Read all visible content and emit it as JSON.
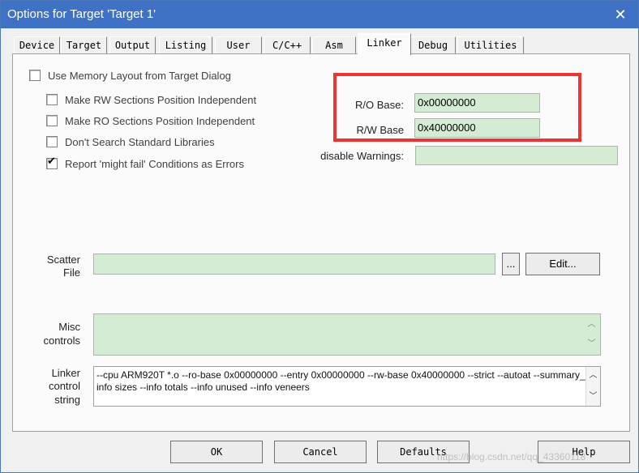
{
  "window": {
    "title": "Options for Target 'Target 1'",
    "close_glyph": "✕"
  },
  "tabs": [
    {
      "label": "Device"
    },
    {
      "label": "Target"
    },
    {
      "label": "Output"
    },
    {
      "label": "Listing"
    },
    {
      "label": "User"
    },
    {
      "label": "C/C++"
    },
    {
      "label": "Asm"
    },
    {
      "label": "Linker",
      "active": true
    },
    {
      "label": "Debug"
    },
    {
      "label": "Utilities"
    }
  ],
  "options": {
    "use_memory_layout": {
      "label": "Use Memory Layout from Target Dialog",
      "checked": false
    },
    "rw_independent": {
      "label": "Make RW Sections Position Independent",
      "checked": false
    },
    "ro_independent": {
      "label": "Make RO Sections Position Independent",
      "checked": false
    },
    "dont_search_libs": {
      "label": "Don't Search Standard Libraries",
      "checked": false
    },
    "might_fail_errors": {
      "label": "Report 'might fail' Conditions as Errors",
      "checked": true,
      "mark": "✔"
    }
  },
  "bases": {
    "ro_label": "R/O Base:",
    "ro_value": "0x00000000",
    "rw_label": "R/W Base",
    "rw_value": "0x40000000",
    "warnings_label": "disable Warnings:",
    "warnings_value": ""
  },
  "scatter": {
    "label_line1": "Scatter",
    "label_line2": "File",
    "value": "",
    "browse_label": "...",
    "edit_label": "Edit..."
  },
  "misc": {
    "label_line1": "Misc",
    "label_line2": "controls",
    "value": ""
  },
  "linker_string": {
    "label_line1": "Linker",
    "label_line2": "control",
    "label_line3": "string",
    "line1": "--cpu ARM920T *.o --ro-base 0x00000000 --entry 0x00000000 --rw-base 0x40000000 --strict --autoat --summary_stderr --",
    "line2": "info sizes --info totals --info unused --info veneers"
  },
  "scroll_glyphs": {
    "up": "︿",
    "down": "﹀"
  },
  "buttons": {
    "ok": "OK",
    "cancel": "Cancel",
    "defaults": "Defaults",
    "help": "Help"
  },
  "watermark": "https://blog.csdn.net/qq_43360118",
  "colors": {
    "titlebar": "#3f72c4",
    "field_bg": "#d4ecd4",
    "highlight": "#ee3333"
  }
}
